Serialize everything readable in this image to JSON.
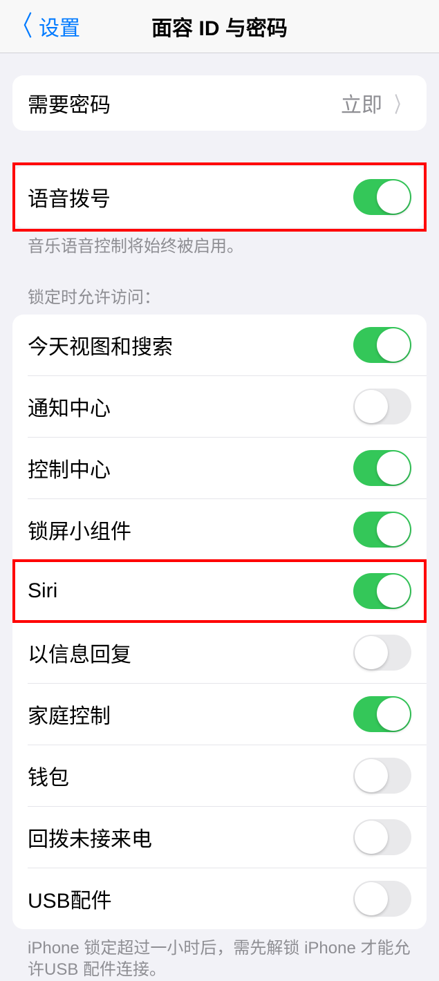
{
  "header": {
    "back_label": "设置",
    "title": "面容 ID 与密码"
  },
  "require_passcode": {
    "label": "需要密码",
    "value": "立即"
  },
  "voice_dial": {
    "label": "语音拨号",
    "on": true,
    "footer": "音乐语音控制将始终被启用。"
  },
  "lock_access": {
    "header": "锁定时允许访问：",
    "items": [
      {
        "label": "今天视图和搜索",
        "on": true
      },
      {
        "label": "通知中心",
        "on": false
      },
      {
        "label": "控制中心",
        "on": true
      },
      {
        "label": "锁屏小组件",
        "on": true
      },
      {
        "label": "Siri",
        "on": true
      },
      {
        "label": "以信息回复",
        "on": false
      },
      {
        "label": "家庭控制",
        "on": true
      },
      {
        "label": "钱包",
        "on": false
      },
      {
        "label": "回拨未接来电",
        "on": false
      },
      {
        "label": "USB配件",
        "on": false
      }
    ],
    "footer": "iPhone 锁定超过一小时后，需先解锁 iPhone 才能允许USB 配件连接。"
  }
}
